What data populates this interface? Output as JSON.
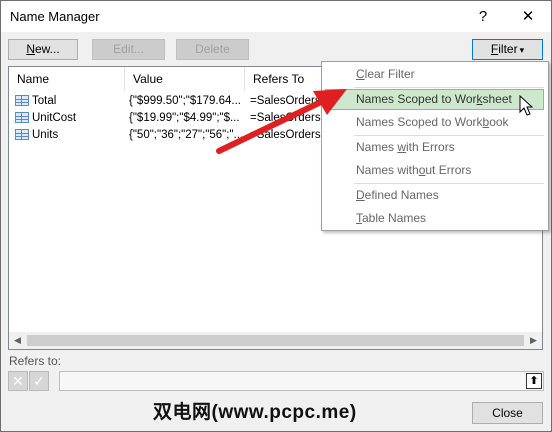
{
  "window": {
    "title": "Name Manager",
    "help": "?",
    "close_glyph": "✕"
  },
  "toolbar": {
    "new_mnemonic": "N",
    "new_rest": "ew...",
    "edit_label": "Edit...",
    "delete_label": "Delete",
    "filter_mnemonic": "F",
    "filter_rest": "ilter",
    "filter_arrow": "▾"
  },
  "columns": [
    "Name",
    "Value",
    "Refers To"
  ],
  "rows": [
    {
      "name": "Total",
      "value": "{\"$999.50\";\"$179.64...",
      "refers": "=SalesOrders!"
    },
    {
      "name": "UnitCost",
      "value": "{\"$19.99\";\"$4.99\";\"$...",
      "refers": "=SalesOrders!"
    },
    {
      "name": "Units",
      "value": "{\"50\";\"36\";\"27\";\"56\";\"...",
      "refers": "=SalesOrders!"
    }
  ],
  "refers_to": {
    "label": "Refers to:",
    "value": ""
  },
  "footer": {
    "close_label": "Close"
  },
  "watermark": "双电网(www.pcpc.me)",
  "filter_menu": {
    "items": [
      {
        "pre": "",
        "key": "C",
        "post": "lear Filter"
      },
      {
        "pre": "Names Scoped to Wor",
        "key": "k",
        "post": "sheet"
      },
      {
        "pre": "Names Scoped to Work",
        "key": "b",
        "post": "ook"
      },
      {
        "pre": "Names ",
        "key": "w",
        "post": "ith Errors"
      },
      {
        "pre": "Names with",
        "key": "o",
        "post": "ut Errors"
      },
      {
        "pre": "",
        "key": "D",
        "post": "efined Names"
      },
      {
        "pre": "",
        "key": "T",
        "post": "able Names"
      }
    ]
  },
  "colors": {
    "highlight": "#cde8cf",
    "arrow": "#e02020",
    "accent": "#0078d7"
  },
  "icons": [
    "table-icon",
    "cancel-x-icon",
    "check-icon",
    "collapse-dialog-icon",
    "mouse-cursor-icon",
    "red-arrow-annotation"
  ]
}
